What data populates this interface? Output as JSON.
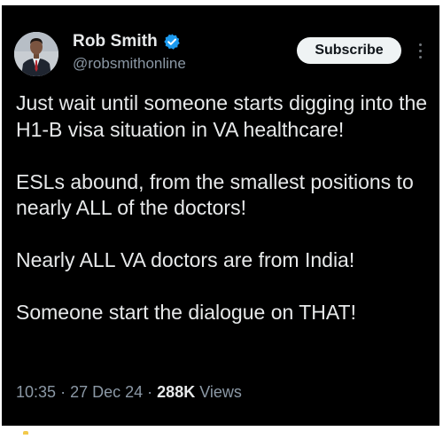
{
  "author": {
    "display_name": "Rob Smith",
    "handle": "@robsmithonline",
    "verified_icon": "verified-badge-icon",
    "avatar_icon": "profile-photo",
    "verified_color": "#1d9bf0"
  },
  "actions": {
    "subscribe_label": "Subscribe",
    "more_icon": "more-options-icon"
  },
  "tweet": {
    "paragraphs": [
      "Just wait until someone starts digging into the H1-B visa situation in VA healthcare!",
      "ESLs abound, from the smallest positions to nearly ALL of the doctors!",
      "Nearly ALL VA doctors are from India!",
      "Someone start the dialogue on THAT!"
    ]
  },
  "meta": {
    "time": "10:35",
    "separator": "·",
    "date": "27 Dec 24",
    "views_count": "288K",
    "views_label": "Views"
  },
  "colors": {
    "background": "#000000",
    "text": "#e7e9ea",
    "secondary_text": "#8b98a5",
    "button_bg": "#eff3f4",
    "button_text": "#0f1419"
  }
}
